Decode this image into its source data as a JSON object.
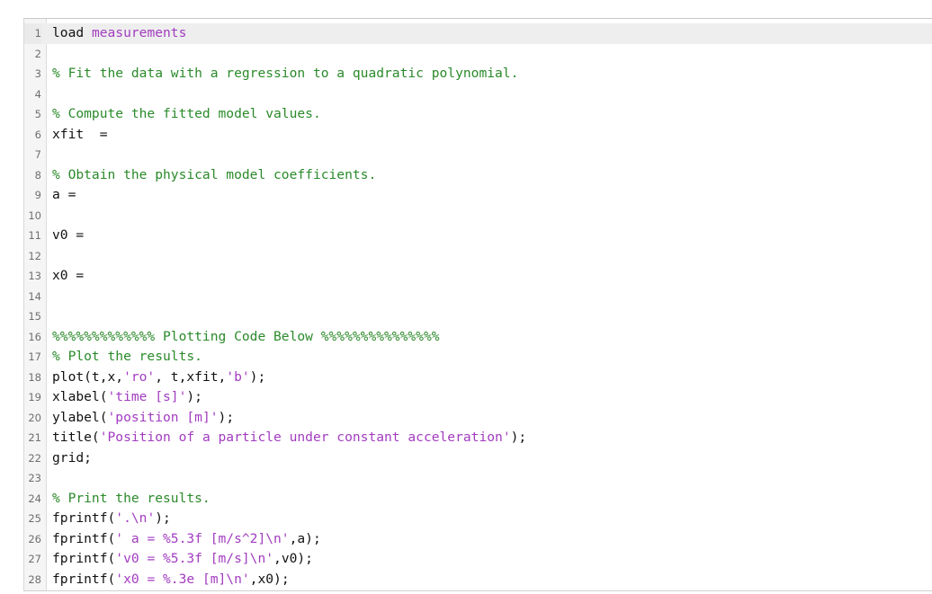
{
  "editor": {
    "current_line": 1,
    "colors": {
      "plain": "#111111",
      "string": "#a23cc0",
      "comment": "#2a8a2a",
      "current_line_bg": "#eeeeee",
      "gutter_bg": "#f5f5f5"
    },
    "lines": [
      {
        "n": "1",
        "tokens": [
          {
            "t": "plain",
            "v": "load "
          },
          {
            "t": "string",
            "v": "measurements"
          }
        ]
      },
      {
        "n": "2",
        "tokens": []
      },
      {
        "n": "3",
        "tokens": [
          {
            "t": "comment",
            "v": "% Fit the data with a regression to a quadratic polynomial."
          }
        ]
      },
      {
        "n": "4",
        "tokens": []
      },
      {
        "n": "5",
        "tokens": [
          {
            "t": "comment",
            "v": "% Compute the fitted model values."
          }
        ]
      },
      {
        "n": "6",
        "tokens": [
          {
            "t": "plain",
            "v": "xfit  ="
          }
        ]
      },
      {
        "n": "7",
        "tokens": []
      },
      {
        "n": "8",
        "tokens": [
          {
            "t": "comment",
            "v": "% Obtain the physical model coefficients."
          }
        ]
      },
      {
        "n": "9",
        "tokens": [
          {
            "t": "plain",
            "v": "a ="
          }
        ]
      },
      {
        "n": "10",
        "tokens": []
      },
      {
        "n": "11",
        "tokens": [
          {
            "t": "plain",
            "v": "v0 ="
          }
        ]
      },
      {
        "n": "12",
        "tokens": []
      },
      {
        "n": "13",
        "tokens": [
          {
            "t": "plain",
            "v": "x0 ="
          }
        ]
      },
      {
        "n": "14",
        "tokens": []
      },
      {
        "n": "15",
        "tokens": []
      },
      {
        "n": "16",
        "tokens": [
          {
            "t": "comment",
            "v": "%%%%%%%%%%%%% Plotting Code Below %%%%%%%%%%%%%%%"
          }
        ]
      },
      {
        "n": "17",
        "tokens": [
          {
            "t": "comment",
            "v": "% Plot the results."
          }
        ]
      },
      {
        "n": "18",
        "tokens": [
          {
            "t": "plain",
            "v": "plot(t,x,"
          },
          {
            "t": "string",
            "v": "'ro'"
          },
          {
            "t": "plain",
            "v": ", t,xfit,"
          },
          {
            "t": "string",
            "v": "'b'"
          },
          {
            "t": "plain",
            "v": ");"
          }
        ]
      },
      {
        "n": "19",
        "tokens": [
          {
            "t": "plain",
            "v": "xlabel("
          },
          {
            "t": "string",
            "v": "'time [s]'"
          },
          {
            "t": "plain",
            "v": ");"
          }
        ]
      },
      {
        "n": "20",
        "tokens": [
          {
            "t": "plain",
            "v": "ylabel("
          },
          {
            "t": "string",
            "v": "'position [m]'"
          },
          {
            "t": "plain",
            "v": ");"
          }
        ]
      },
      {
        "n": "21",
        "tokens": [
          {
            "t": "plain",
            "v": "title("
          },
          {
            "t": "string",
            "v": "'Position of a particle under constant acceleration'"
          },
          {
            "t": "plain",
            "v": ");"
          }
        ]
      },
      {
        "n": "22",
        "tokens": [
          {
            "t": "plain",
            "v": "grid;"
          }
        ]
      },
      {
        "n": "23",
        "tokens": []
      },
      {
        "n": "24",
        "tokens": [
          {
            "t": "comment",
            "v": "% Print the results."
          }
        ]
      },
      {
        "n": "25",
        "tokens": [
          {
            "t": "plain",
            "v": "fprintf("
          },
          {
            "t": "string",
            "v": "'.\\n'"
          },
          {
            "t": "plain",
            "v": ");"
          }
        ]
      },
      {
        "n": "26",
        "tokens": [
          {
            "t": "plain",
            "v": "fprintf("
          },
          {
            "t": "string",
            "v": "' a = %5.3f [m/s^2]\\n'"
          },
          {
            "t": "plain",
            "v": ",a);"
          }
        ]
      },
      {
        "n": "27",
        "tokens": [
          {
            "t": "plain",
            "v": "fprintf("
          },
          {
            "t": "string",
            "v": "'v0 = %5.3f [m/s]\\n'"
          },
          {
            "t": "plain",
            "v": ",v0);"
          }
        ]
      },
      {
        "n": "28",
        "tokens": [
          {
            "t": "plain",
            "v": "fprintf("
          },
          {
            "t": "string",
            "v": "'x0 = %.3e [m]\\n'"
          },
          {
            "t": "plain",
            "v": ",x0);"
          }
        ]
      }
    ]
  }
}
